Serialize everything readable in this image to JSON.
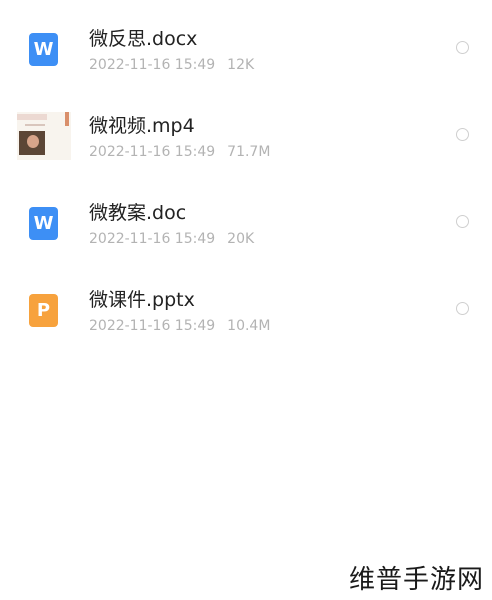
{
  "files": [
    {
      "name": "微反思.docx",
      "date": "2022-11-16 15:49",
      "size": "12K",
      "icon": "word-doc-icon",
      "icon_glyph": "W",
      "icon_color": "#3d8ff5"
    },
    {
      "name": "微视频.mp4",
      "date": "2022-11-16 15:49",
      "size": "71.7M",
      "icon": "video-thumbnail"
    },
    {
      "name": "微教案.doc",
      "date": "2022-11-16 15:49",
      "size": "20K",
      "icon": "word-doc-icon",
      "icon_glyph": "W",
      "icon_color": "#3d8ff5"
    },
    {
      "name": "微课件.pptx",
      "date": "2022-11-16 15:49",
      "size": "10.4M",
      "icon": "powerpoint-icon",
      "icon_glyph": "P",
      "icon_color": "#f7a23d"
    }
  ],
  "watermark": "维普手游网",
  "colors": {
    "name_text": "#222222",
    "meta_text": "#b3b3b3",
    "radio_border": "#cfcfcf"
  }
}
